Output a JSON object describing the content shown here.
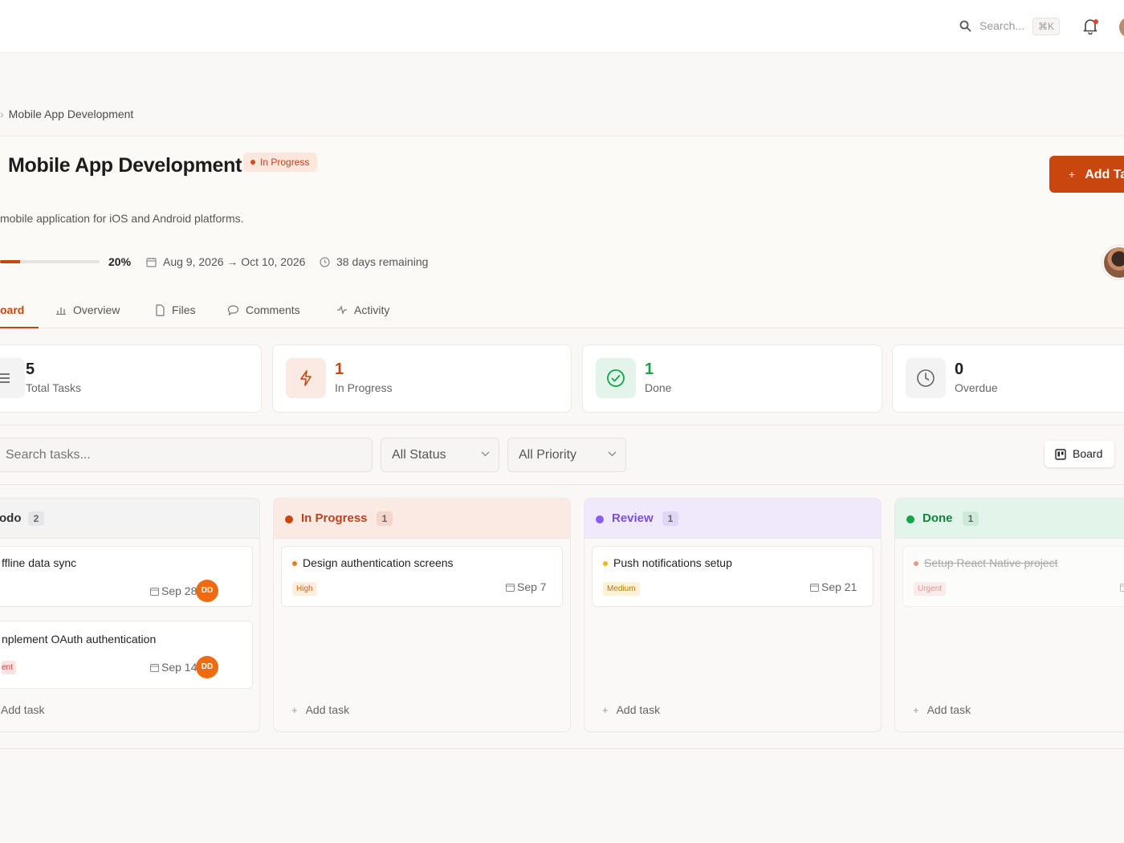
{
  "topbar": {
    "search_placeholder": "Search...",
    "shortcut": "⌘K",
    "notification_icon": "bell-icon",
    "search_icon": "search-icon"
  },
  "breadcrumb": {
    "current": "Mobile App Development"
  },
  "project": {
    "title": "Mobile App Development",
    "status": "In Progress",
    "description": "mobile application for iOS and Android platforms.",
    "progress_percent": 20,
    "progress_label": "20%",
    "date_range": "Aug 9, 2026 → Oct 10, 2026",
    "days_remaining": "38 days remaining",
    "add_task_label": "Add Ta"
  },
  "tabs": [
    {
      "label": "oard",
      "icon": "board-icon",
      "active": true
    },
    {
      "label": "Overview",
      "icon": "bar-chart-icon",
      "active": false
    },
    {
      "label": "Files",
      "icon": "file-icon",
      "active": false
    },
    {
      "label": "Comments",
      "icon": "comment-icon",
      "active": false
    },
    {
      "label": "Activity",
      "icon": "activity-icon",
      "active": false
    }
  ],
  "stats": [
    {
      "value": "5",
      "label": "Total Tasks",
      "icon": "list-icon"
    },
    {
      "value": "1",
      "label": "In Progress",
      "icon": "lightning-icon"
    },
    {
      "value": "1",
      "label": "Done",
      "icon": "check-circle-icon"
    },
    {
      "value": "0",
      "label": "Overdue",
      "icon": "clock-icon"
    }
  ],
  "filters": {
    "search_placeholder": "Search tasks...",
    "status": "All Status",
    "priority": "All Priority",
    "view": "Board"
  },
  "columns": [
    {
      "title": "odo",
      "count": "2",
      "color": "#9aa0a6",
      "add_label": "Add task",
      "tasks": [
        {
          "title": "ffline data sync",
          "priority": "",
          "due": "Sep 28",
          "assignee": "DD"
        },
        {
          "title": "nplement OAuth authentication",
          "priority": "ent",
          "due": "Sep 14",
          "assignee": "DD"
        }
      ]
    },
    {
      "title": "In Progress",
      "count": "1",
      "color": "#c9470e",
      "add_label": "Add task",
      "tasks": [
        {
          "title": "Design authentication screens",
          "priority": "High",
          "due": "Sep 7"
        }
      ]
    },
    {
      "title": "Review",
      "count": "1",
      "color": "#8b5cf6",
      "add_label": "Add task",
      "tasks": [
        {
          "title": "Push notifications setup",
          "priority": "Medium",
          "due": "Sep 21"
        }
      ]
    },
    {
      "title": "Done",
      "count": "1",
      "color": "#16a34a",
      "add_label": "Add task",
      "tasks": [
        {
          "title": "Setup React Native project",
          "priority": "Urgent",
          "completed": true
        }
      ]
    }
  ],
  "colors": {
    "accent": "#c9470e",
    "in_progress_bg": "#fbe9e4",
    "review_bg": "#efe9fb",
    "done_bg": "#e3f5ea",
    "todo_bg": "#f3f3f4"
  }
}
